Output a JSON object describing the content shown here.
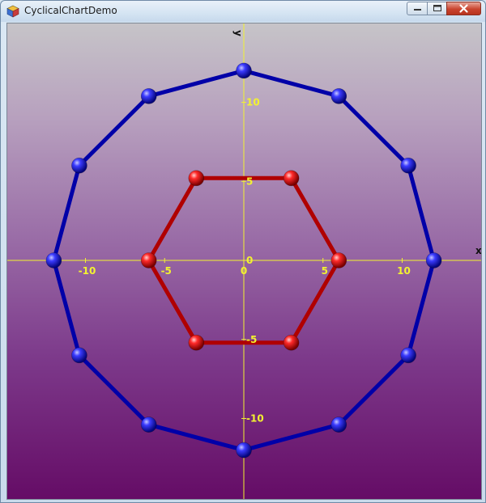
{
  "window": {
    "title": "CyclicalChartDemo",
    "icon": "app-cube-icon",
    "controls": {
      "minimize_icon": "minimize-icon",
      "maximize_icon": "maximize-icon",
      "close_icon": "close-icon"
    }
  },
  "colors": {
    "axis": "#f2f230",
    "tick_label": "#f2f230",
    "axis_title": "#111111",
    "outer_series": "#0000a8",
    "inner_series": "#b00000",
    "outer_marker": "#2b2bf0",
    "inner_marker": "#f02020"
  },
  "chart_data": {
    "type": "line",
    "xlabel": "x",
    "ylabel": "y",
    "xlim": [
      -15,
      15
    ],
    "ylim": [
      -15,
      15
    ],
    "x_ticks": [
      -10,
      -5,
      0,
      5,
      10
    ],
    "x_tick_labels": [
      "-10",
      "-5",
      "0",
      "5",
      "10"
    ],
    "y_ticks": [
      10,
      5,
      0,
      -5,
      -10
    ],
    "y_tick_labels": [
      "10",
      "5",
      "0",
      "-5",
      "-10"
    ],
    "grid": false,
    "legend": "none",
    "series": [
      {
        "closed": true,
        "points": [
          [
            0,
            12
          ],
          [
            6,
            10.39
          ],
          [
            10.39,
            6
          ],
          [
            12,
            0
          ],
          [
            10.39,
            -6
          ],
          [
            6,
            -10.39
          ],
          [
            0,
            -12
          ],
          [
            -6,
            -10.39
          ],
          [
            -10.39,
            -6
          ],
          [
            -12,
            0
          ],
          [
            -10.39,
            6
          ],
          [
            -6,
            10.39
          ]
        ]
      },
      {
        "closed": true,
        "points": [
          [
            6,
            0
          ],
          [
            3,
            5.2
          ],
          [
            -3,
            5.2
          ],
          [
            -6,
            0
          ],
          [
            -3,
            -5.2
          ],
          [
            3,
            -5.2
          ]
        ]
      }
    ]
  }
}
